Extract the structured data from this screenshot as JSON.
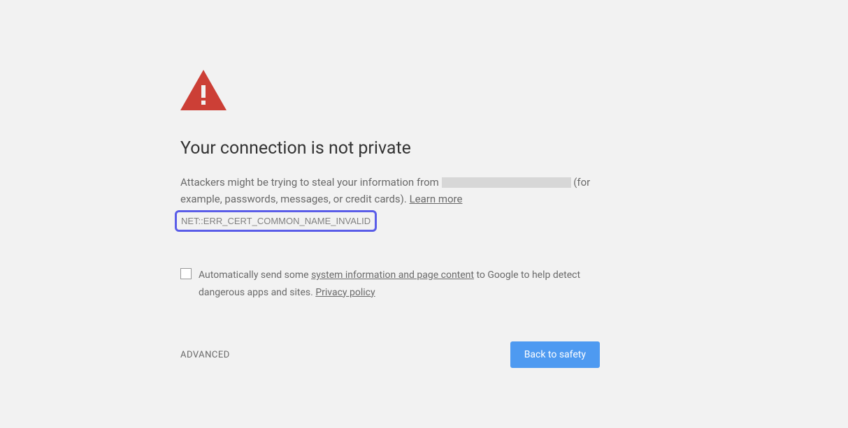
{
  "heading": "Your connection is not private",
  "body": {
    "prefix": "Attackers might be trying to steal your information from ",
    "suffix": " (for example, passwords, messages, or credit cards). ",
    "learn_more": "Learn more"
  },
  "error_code": "NET::ERR_CERT_COMMON_NAME_INVALID",
  "checkbox": {
    "t1": "Automatically send some ",
    "link1": "system information and page content",
    "t2": " to Google to help detect dangerous apps and sites. ",
    "link2": "Privacy policy"
  },
  "buttons": {
    "advanced": "ADVANCED",
    "back": "Back to safety"
  }
}
